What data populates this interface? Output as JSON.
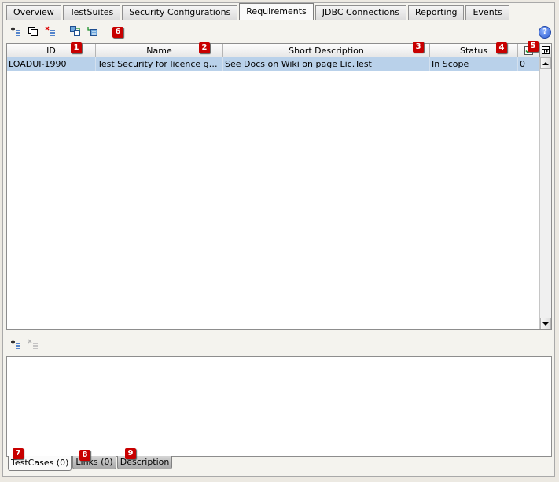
{
  "tabs": [
    {
      "label": "Overview"
    },
    {
      "label": "TestSuites"
    },
    {
      "label": "Security Configurations"
    },
    {
      "label": "Requirements"
    },
    {
      "label": "JDBC Connections"
    },
    {
      "label": "Reporting"
    },
    {
      "label": "Events"
    }
  ],
  "active_tab": "Requirements",
  "toolbar": {
    "icons": [
      "add-requirement-icon",
      "clone-requirement-icon",
      "delete-requirement-icon",
      "import-requirements-icon",
      "export-requirements-icon"
    ],
    "help_label": "?"
  },
  "badges": [
    "1",
    "2",
    "3",
    "4",
    "5",
    "6",
    "7",
    "8",
    "9"
  ],
  "table": {
    "columns": [
      "ID",
      "Name",
      "Short Description",
      "Status",
      ""
    ],
    "rows": [
      {
        "id": "LOADUI-1990",
        "name": "Test Security for licence gener…",
        "short_description": "See Docs on Wiki on page Lic.Test",
        "status": "In Scope",
        "count": "0"
      }
    ],
    "checkbox_column_icon": "checkbox-checked-icon",
    "column_chooser_icon": "column-chooser-icon"
  },
  "lower_toolbar": {
    "icons": [
      "add-testcase-icon",
      "remove-testcase-icon"
    ]
  },
  "bottom_tabs": [
    {
      "label": "TestCases (0)"
    },
    {
      "label": "Links (0)"
    },
    {
      "label": "Description"
    }
  ],
  "colors": {
    "selection": "#b9d1ea",
    "badge": "#c80000",
    "background": "#ece9e2"
  }
}
